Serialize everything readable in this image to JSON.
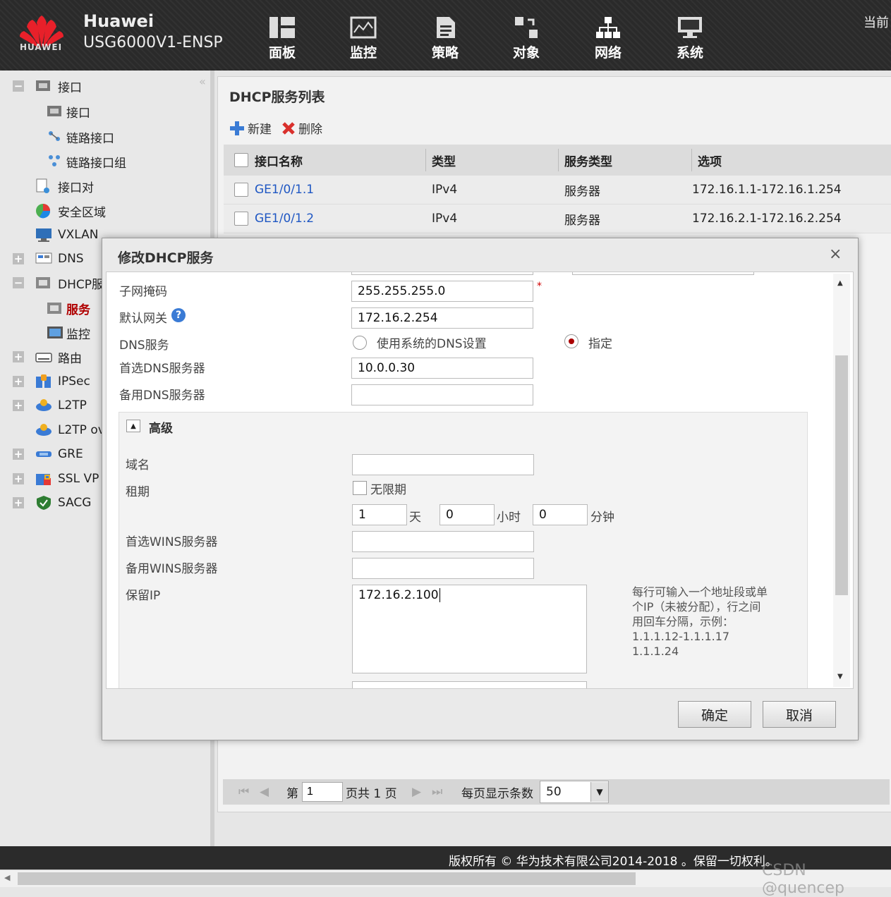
{
  "header": {
    "brand": "Huawei",
    "model": "USG6000V1-ENSP",
    "logo_text": "HUAWEI",
    "top_right": "当前",
    "nav": [
      {
        "label": "面板",
        "icon": "dashboard-icon"
      },
      {
        "label": "监控",
        "icon": "monitor-icon"
      },
      {
        "label": "策略",
        "icon": "policy-icon"
      },
      {
        "label": "对象",
        "icon": "object-icon"
      },
      {
        "label": "网络",
        "icon": "network-icon"
      },
      {
        "label": "系统",
        "icon": "system-icon"
      }
    ]
  },
  "sidebar": {
    "collapse_glyph": "«",
    "items": [
      {
        "label": "接口",
        "toggle": "−"
      },
      {
        "label": "接口"
      },
      {
        "label": "链路接口"
      },
      {
        "label": "链路接口组"
      },
      {
        "label": "接口对"
      },
      {
        "label": "安全区域"
      },
      {
        "label": "VXLAN"
      },
      {
        "label": "DNS",
        "toggle": "+"
      },
      {
        "label": "DHCP服",
        "toggle": "−"
      },
      {
        "label": "服务"
      },
      {
        "label": "监控"
      },
      {
        "label": "路由",
        "toggle": "+"
      },
      {
        "label": "IPSec",
        "toggle": "+"
      },
      {
        "label": "L2TP",
        "toggle": "+"
      },
      {
        "label": "L2TP ov"
      },
      {
        "label": "GRE",
        "toggle": "+"
      },
      {
        "label": "SSL VP",
        "toggle": "+"
      },
      {
        "label": "SACG",
        "toggle": "+"
      }
    ]
  },
  "main": {
    "title": "DHCP服务列表",
    "toolbar": {
      "new_label": "新建",
      "delete_label": "删除"
    },
    "grid": {
      "columns": [
        "接口名称",
        "类型",
        "服务类型",
        "选项"
      ],
      "rows": [
        [
          "GE1/0/1.1",
          "IPv4",
          "服务器",
          "172.16.1.1-172.16.1.254"
        ],
        [
          "GE1/0/1.2",
          "IPv4",
          "服务器",
          "172.16.2.1-172.16.2.254"
        ]
      ]
    },
    "pager": {
      "page_prefix": "第",
      "page_value": "1",
      "page_suffix": "页共 1 页",
      "per_page_label": "每页显示条数",
      "per_page_value": "50"
    }
  },
  "dialog": {
    "title": "修改DHCP服务",
    "close_glyph": "×",
    "fields": {
      "subnet_mask_label": "子网掩码",
      "subnet_mask_value": "255.255.255.0",
      "required_mark": "*",
      "gateway_label": "默认网关",
      "help_glyph": "?",
      "dns_label": "DNS服务",
      "dns_option_system": "使用系统的DNS设置",
      "dns_option_specify": "指定",
      "dns_selected": "指定",
      "primary_dns_label": "首选DNS服务器",
      "primary_dns_value": "10.0.0.30",
      "secondary_dns_label": "备用DNS服务器",
      "secondary_dns_value": "",
      "gateway_value": "172.16.2.254"
    },
    "advanced": {
      "title": "高级",
      "domain_label": "域名",
      "domain_value": "",
      "lease_label": "租期",
      "unlimited_label": "无限期",
      "unlimited_checked": false,
      "days_value": "1",
      "days_unit": "天",
      "hours_value": "0",
      "hours_unit": "小时",
      "minutes_value": "0",
      "minutes_unit": "分钟",
      "primary_wins_label": "首选WINS服务器",
      "primary_wins_value": "",
      "secondary_wins_label": "备用WINS服务器",
      "secondary_wins_value": "",
      "reserved_ip_label": "保留IP",
      "reserved_ip_value": "172.16.2.100",
      "reserved_ip_hint": [
        "每行可输入一个地址段或单",
        "个IP（未被分配），行之间",
        "用回车分隔，示例：",
        "1.1.1.12-1.1.1.17",
        "1.1.1.24"
      ]
    },
    "buttons": {
      "ok": "确定",
      "cancel": "取消"
    }
  },
  "footer": {
    "copyright": "版权所有 © 华为技术有限公司2014-2018 。保留一切权利。",
    "watermark": "CSDN @quencep"
  },
  "colors": {
    "header_bg": "#2a2a2a",
    "link": "#1f57c3",
    "selected_tree": "#b00000",
    "required": "#d00000"
  }
}
